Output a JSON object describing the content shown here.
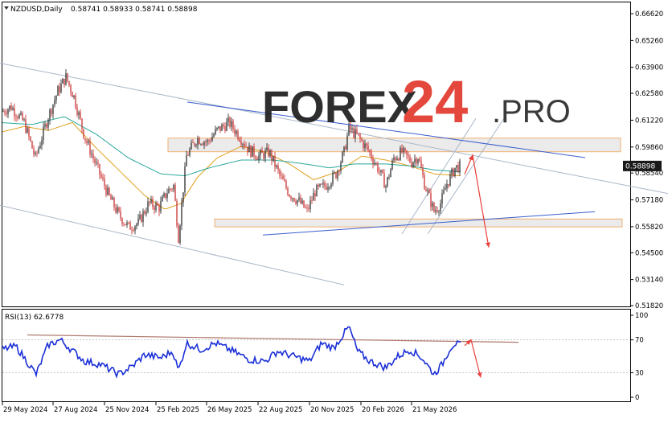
{
  "header": {
    "symbol": "NZDUSD,Daily",
    "ohlc": "0.58741 0.58933 0.58741 0.58898"
  },
  "watermark": {
    "part1": "FOREX",
    "part2": "24",
    "part3": ".PRO"
  },
  "colors": {
    "bull_candle": "#1a1a1a",
    "bear_candle": "#c41f1f",
    "ma_fast": "#e0a020",
    "ma_slow": "#2aa89a",
    "trend_blue": "#3a5fcd",
    "channel_gray": "#a9b7c9",
    "forecast_arrow": "#e8403a",
    "rsi_line": "#1a2fd6",
    "zone_border": "#f0b070",
    "zone_fill": "#e6e6e6"
  },
  "chart_data": [
    {
      "type": "candlestick",
      "title": "NZDUSD,Daily",
      "series": [
        {
          "name": "NZDUSD,Daily"
        }
      ],
      "last_price": 0.58898,
      "last_price_label": "0.58898",
      "y_ticks": [
        "0.66620",
        "0.65260",
        "0.63900",
        "0.62580",
        "0.61220",
        "0.59860",
        "0.58540",
        "0.57180",
        "0.55820",
        "0.54500",
        "0.53140",
        "0.51820"
      ],
      "ylim": [
        0.5182,
        0.6662
      ],
      "x_ticks": [
        "29 May 2024",
        "27 Aug 2024",
        "25 Nov 2024",
        "25 Feb 2025",
        "26 May 2025",
        "22 Aug 2025",
        "20 Nov 2025",
        "20 Feb 2026",
        "21 May 2026"
      ],
      "path_anchors": [
        [
          0,
          0.616
        ],
        [
          14,
          0.619
        ],
        [
          30,
          0.611
        ],
        [
          44,
          0.593
        ],
        [
          60,
          0.614
        ],
        [
          72,
          0.627
        ],
        [
          82,
          0.634
        ],
        [
          92,
          0.624
        ],
        [
          105,
          0.604
        ],
        [
          120,
          0.589
        ],
        [
          135,
          0.574
        ],
        [
          148,
          0.564
        ],
        [
          160,
          0.558
        ],
        [
          172,
          0.56
        ],
        [
          185,
          0.57
        ],
        [
          198,
          0.568
        ],
        [
          208,
          0.576
        ],
        [
          216,
          0.579
        ],
        [
          222,
          0.553
        ],
        [
          232,
          0.594
        ],
        [
          245,
          0.603
        ],
        [
          258,
          0.601
        ],
        [
          270,
          0.607
        ],
        [
          285,
          0.611
        ],
        [
          298,
          0.604
        ],
        [
          310,
          0.597
        ],
        [
          322,
          0.594
        ],
        [
          335,
          0.596
        ],
        [
          348,
          0.584
        ],
        [
          360,
          0.575
        ],
        [
          372,
          0.571
        ],
        [
          382,
          0.566
        ],
        [
          392,
          0.576
        ],
        [
          405,
          0.579
        ],
        [
          418,
          0.585
        ],
        [
          428,
          0.596
        ],
        [
          434,
          0.608
        ],
        [
          445,
          0.604
        ],
        [
          458,
          0.597
        ],
        [
          470,
          0.588
        ],
        [
          480,
          0.579
        ],
        [
          490,
          0.593
        ],
        [
          500,
          0.596
        ],
        [
          512,
          0.591
        ],
        [
          520,
          0.594
        ],
        [
          528,
          0.58
        ],
        [
          540,
          0.566
        ],
        [
          548,
          0.57
        ],
        [
          556,
          0.58
        ],
        [
          566,
          0.588
        ],
        [
          573,
          0.589
        ]
      ],
      "ma_fast_anchors": [
        [
          0,
          0.606
        ],
        [
          30,
          0.609
        ],
        [
          60,
          0.607
        ],
        [
          90,
          0.611
        ],
        [
          120,
          0.598
        ],
        [
          150,
          0.586
        ],
        [
          180,
          0.574
        ],
        [
          205,
          0.567
        ],
        [
          225,
          0.57
        ],
        [
          245,
          0.583
        ],
        [
          270,
          0.593
        ],
        [
          300,
          0.599
        ],
        [
          330,
          0.596
        ],
        [
          360,
          0.59
        ],
        [
          390,
          0.582
        ],
        [
          420,
          0.586
        ],
        [
          450,
          0.594
        ],
        [
          480,
          0.592
        ],
        [
          510,
          0.589
        ],
        [
          540,
          0.585
        ],
        [
          573,
          0.584
        ]
      ],
      "ma_slow_anchors": [
        [
          0,
          0.611
        ],
        [
          40,
          0.61
        ],
        [
          80,
          0.614
        ],
        [
          120,
          0.605
        ],
        [
          160,
          0.593
        ],
        [
          200,
          0.585
        ],
        [
          230,
          0.584
        ],
        [
          260,
          0.588
        ],
        [
          300,
          0.592
        ],
        [
          340,
          0.592
        ],
        [
          380,
          0.59
        ],
        [
          410,
          0.588
        ],
        [
          440,
          0.59
        ],
        [
          480,
          0.59
        ],
        [
          510,
          0.589
        ],
        [
          540,
          0.587
        ],
        [
          573,
          0.586
        ]
      ],
      "annotations": {
        "resistance_zone": [
          0.5962,
          0.6031
        ],
        "support_zone": [
          0.5581,
          0.5621
        ],
        "upper_channel": [
          [
            0,
            0.6411
          ],
          [
            831,
            0.575
          ]
        ],
        "lower_channel": [
          [
            0,
            0.569
          ],
          [
            428,
            0.5287
          ]
        ],
        "upper_blue": [
          [
            233,
            0.6214
          ],
          [
            728,
            0.5932
          ]
        ],
        "lower_blue": [
          [
            327,
            0.554
          ],
          [
            740,
            0.5658
          ]
        ],
        "rising_channel_left": [
          [
            500,
            0.5545
          ],
          [
            592,
            0.6131
          ]
        ],
        "rising_channel_right": [
          [
            532,
            0.5545
          ],
          [
            627,
            0.6131
          ]
        ],
        "forecast_arrow": [
          [
            578,
            0.5848
          ],
          [
            588,
            0.5945
          ],
          [
            608,
            0.5477
          ]
        ]
      }
    },
    {
      "type": "line",
      "title": "RSI(13) 62.6778",
      "series": [
        {
          "name": "RSI(13)",
          "last_value": 62.6778
        }
      ],
      "ylim": [
        0,
        100
      ],
      "y_ticks": [
        "100",
        "70",
        "30",
        "0"
      ],
      "levels": [
        70,
        30
      ],
      "anchors": [
        [
          0,
          58
        ],
        [
          20,
          62
        ],
        [
          45,
          28
        ],
        [
          60,
          64
        ],
        [
          75,
          70
        ],
        [
          90,
          57
        ],
        [
          105,
          44
        ],
        [
          125,
          40
        ],
        [
          148,
          28
        ],
        [
          165,
          38
        ],
        [
          180,
          52
        ],
        [
          200,
          48
        ],
        [
          215,
          56
        ],
        [
          222,
          32
        ],
        [
          232,
          66
        ],
        [
          250,
          58
        ],
        [
          268,
          66
        ],
        [
          290,
          56
        ],
        [
          310,
          46
        ],
        [
          330,
          44
        ],
        [
          345,
          56
        ],
        [
          365,
          50
        ],
        [
          385,
          44
        ],
        [
          400,
          66
        ],
        [
          415,
          60
        ],
        [
          434,
          86
        ],
        [
          445,
          56
        ],
        [
          460,
          44
        ],
        [
          480,
          36
        ],
        [
          495,
          50
        ],
        [
          510,
          58
        ],
        [
          525,
          48
        ],
        [
          540,
          28
        ],
        [
          550,
          40
        ],
        [
          560,
          60
        ],
        [
          566,
          66
        ],
        [
          573,
          63
        ]
      ],
      "trend_line": [
        [
          34,
          76
        ],
        [
          645,
          67
        ]
      ],
      "forecast_arrow": [
        [
          578,
          63
        ],
        [
          586,
          70
        ],
        [
          598,
          24
        ]
      ]
    }
  ]
}
